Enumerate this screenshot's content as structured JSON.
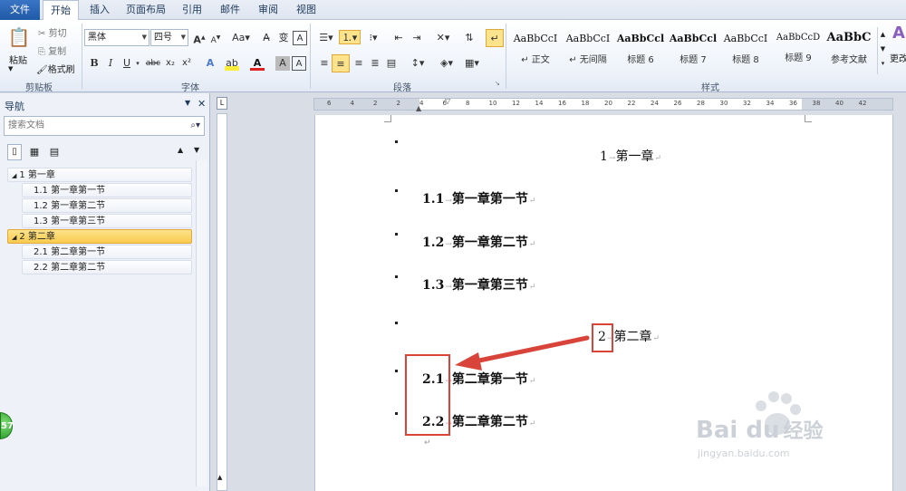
{
  "tabs": [
    "文件",
    "开始",
    "插入",
    "页面布局",
    "引用",
    "邮件",
    "审阅",
    "视图"
  ],
  "clipboard": {
    "paste": "粘贴",
    "cut": "剪切",
    "copy": "复制",
    "format_painter": "格式刷",
    "label": "剪贴板"
  },
  "font": {
    "name": "黑体",
    "size": "四号",
    "label": "字体"
  },
  "paragraph": {
    "label": "段落"
  },
  "styles": {
    "label": "样式",
    "items": [
      {
        "sample": "AaBbCcI",
        "name": "↵ 正文"
      },
      {
        "sample": "AaBbCcI",
        "name": "↵ 无间隔"
      },
      {
        "sample": "AaBbCcl",
        "name": "标题 6"
      },
      {
        "sample": "AaBbCcl",
        "name": "标题 7"
      },
      {
        "sample": "AaBbCcI",
        "name": "标题 8"
      },
      {
        "sample": "AaBbCcD",
        "name": "标题 9"
      },
      {
        "sample": "AaBbC",
        "name": "参考文献"
      }
    ],
    "change": "更改"
  },
  "nav": {
    "title": "导航",
    "search_placeholder": "搜索文档",
    "tree": [
      {
        "label": "1 第一章",
        "level": 1,
        "selected": false
      },
      {
        "label": "1.1 第一章第一节",
        "level": 2,
        "selected": false
      },
      {
        "label": "1.2 第一章第二节",
        "level": 2,
        "selected": false
      },
      {
        "label": "1.3 第一章第三节",
        "level": 2,
        "selected": false
      },
      {
        "label": "2 第二章",
        "level": 1,
        "selected": true
      },
      {
        "label": "2.1 第二章第一节",
        "level": 2,
        "selected": false
      },
      {
        "label": "2.2 第二章第二节",
        "level": 2,
        "selected": false
      }
    ]
  },
  "document": {
    "headings": [
      {
        "num": "1",
        "text": "第一章",
        "bold": false
      },
      {
        "num": "1.1",
        "text": "第一章第一节",
        "bold": true
      },
      {
        "num": "1.2",
        "text": "第一章第二节",
        "bold": true
      },
      {
        "num": "1.3",
        "text": "第一章第三节",
        "bold": true
      },
      {
        "num": "2",
        "text": "第二章",
        "bold": false
      },
      {
        "num": "2.1",
        "text": "第二章第一节",
        "bold": true
      },
      {
        "num": "2.2",
        "text": "第二章第二节",
        "bold": true
      }
    ]
  },
  "ruler_numbers": [
    "6",
    "4",
    "2",
    "2",
    "4",
    "6",
    "8",
    "10",
    "12",
    "14",
    "16",
    "18",
    "20",
    "22",
    "24",
    "26",
    "28",
    "30",
    "32",
    "34",
    "36",
    "38",
    "40",
    "42"
  ],
  "badge": "57",
  "watermark": {
    "brand": "Bai du",
    "sub": "经验",
    "url": "jingyan.baidu.com"
  },
  "colors": {
    "accent": "#1f5aa8",
    "highlight": "#f9cb4e",
    "annotation": "#d9443a"
  }
}
